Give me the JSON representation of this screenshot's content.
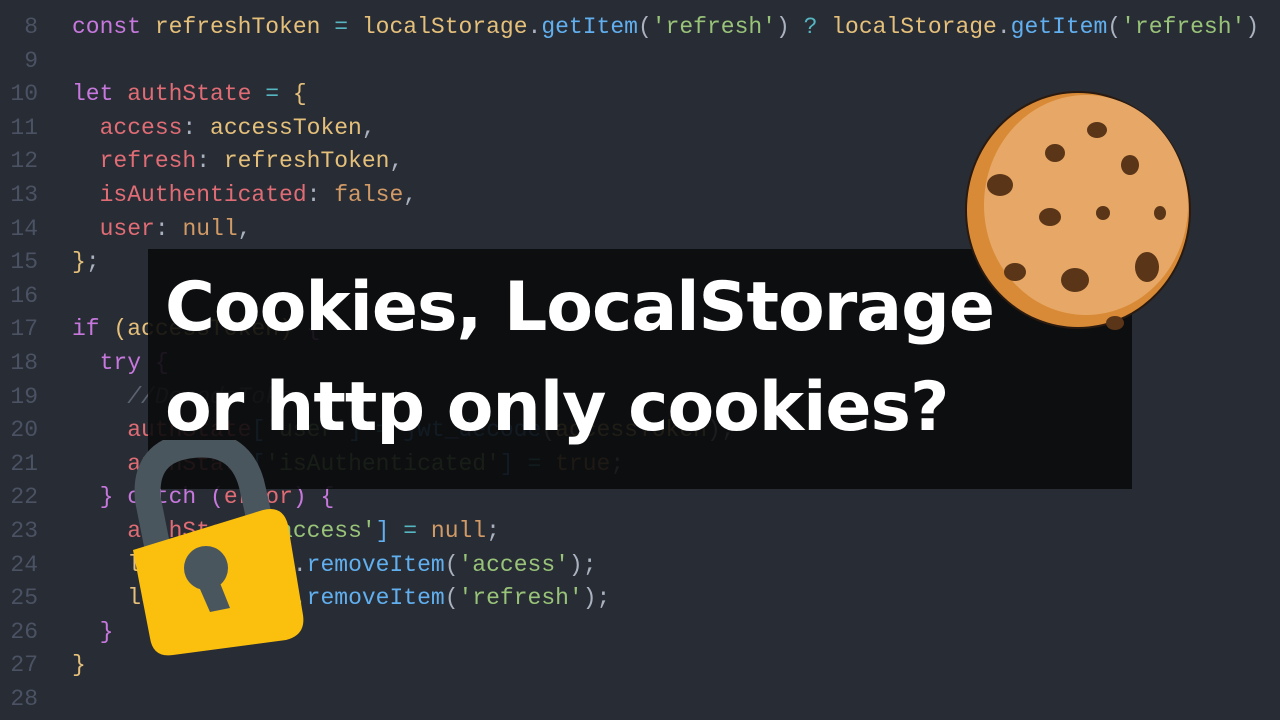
{
  "code_lines": [
    {
      "n": "8",
      "tokens": [
        [
          "const ",
          "kw"
        ],
        [
          "refreshToken ",
          "var"
        ],
        [
          "= ",
          "op"
        ],
        [
          "localStorage",
          "var"
        ],
        [
          ".",
          "txt"
        ],
        [
          "getItem",
          "fn"
        ],
        [
          "(",
          "txt"
        ],
        [
          "'refresh'",
          "str"
        ],
        [
          ") ",
          "txt"
        ],
        [
          "? ",
          "op"
        ],
        [
          "localStorage",
          "var"
        ],
        [
          ".",
          "txt"
        ],
        [
          "getItem",
          "fn"
        ],
        [
          "(",
          "txt"
        ],
        [
          "'refresh'",
          "str"
        ],
        [
          ")",
          "txt"
        ]
      ]
    },
    {
      "n": "9",
      "tokens": []
    },
    {
      "n": "10",
      "tokens": [
        [
          "let ",
          "kw"
        ],
        [
          "authState ",
          "prop"
        ],
        [
          "= ",
          "op"
        ],
        [
          "{",
          "brace"
        ]
      ]
    },
    {
      "n": "11",
      "tokens": [
        [
          "  access",
          "prop"
        ],
        [
          ": ",
          "txt"
        ],
        [
          "accessToken",
          "var"
        ],
        [
          ",",
          "txt"
        ]
      ]
    },
    {
      "n": "12",
      "tokens": [
        [
          "  refresh",
          "prop"
        ],
        [
          ": ",
          "txt"
        ],
        [
          "refreshToken",
          "var"
        ],
        [
          ",",
          "txt"
        ]
      ]
    },
    {
      "n": "13",
      "tokens": [
        [
          "  isAuthenticated",
          "prop"
        ],
        [
          ": ",
          "txt"
        ],
        [
          "false",
          "lit"
        ],
        [
          ",",
          "txt"
        ]
      ]
    },
    {
      "n": "14",
      "tokens": [
        [
          "  user",
          "prop"
        ],
        [
          ": ",
          "txt"
        ],
        [
          "null",
          "lit"
        ],
        [
          ",",
          "txt"
        ]
      ]
    },
    {
      "n": "15",
      "tokens": [
        [
          "}",
          "brace"
        ],
        [
          ";",
          "txt"
        ]
      ]
    },
    {
      "n": "16",
      "tokens": []
    },
    {
      "n": "17",
      "tokens": [
        [
          "if ",
          "kw"
        ],
        [
          "(",
          "brace"
        ],
        [
          "accessToken",
          "var"
        ],
        [
          ") ",
          "brace"
        ],
        [
          "{",
          "kw"
        ]
      ]
    },
    {
      "n": "18",
      "tokens": [
        [
          "  try ",
          "kw"
        ],
        [
          "{",
          "kw"
        ]
      ]
    },
    {
      "n": "19",
      "tokens": [
        [
          "    //DecodeToken",
          "cm"
        ]
      ]
    },
    {
      "n": "20",
      "tokens": [
        [
          "    authState",
          "prop"
        ],
        [
          "[",
          "fn"
        ],
        [
          "'user'",
          "str"
        ],
        [
          "] ",
          "fn"
        ],
        [
          "= ",
          "op"
        ],
        [
          "jwt_decode",
          "fn"
        ],
        [
          "(",
          "txt"
        ],
        [
          "accessToken",
          "var"
        ],
        [
          ");",
          "txt"
        ]
      ]
    },
    {
      "n": "21",
      "tokens": [
        [
          "    authState",
          "prop"
        ],
        [
          "[",
          "fn"
        ],
        [
          "'isAuthenticated'",
          "str"
        ],
        [
          "] ",
          "fn"
        ],
        [
          "= ",
          "op"
        ],
        [
          "true",
          "lit"
        ],
        [
          ";",
          "txt"
        ]
      ]
    },
    {
      "n": "22",
      "tokens": [
        [
          "  } ",
          "kw"
        ],
        [
          "catch ",
          "kw"
        ],
        [
          "(",
          "kw"
        ],
        [
          "error",
          "prop"
        ],
        [
          ") ",
          "kw"
        ],
        [
          "{",
          "kw"
        ]
      ]
    },
    {
      "n": "23",
      "tokens": [
        [
          "    authState",
          "prop"
        ],
        [
          "[",
          "fn"
        ],
        [
          "'access'",
          "str"
        ],
        [
          "] ",
          "fn"
        ],
        [
          "= ",
          "op"
        ],
        [
          "null",
          "lit"
        ],
        [
          ";",
          "txt"
        ]
      ]
    },
    {
      "n": "24",
      "tokens": [
        [
          "    localStorage",
          "var"
        ],
        [
          ".",
          "txt"
        ],
        [
          "removeItem",
          "fn"
        ],
        [
          "(",
          "txt"
        ],
        [
          "'access'",
          "str"
        ],
        [
          ");",
          "txt"
        ]
      ]
    },
    {
      "n": "25",
      "tokens": [
        [
          "    localStorage",
          "var"
        ],
        [
          ".",
          "txt"
        ],
        [
          "removeItem",
          "fn"
        ],
        [
          "(",
          "txt"
        ],
        [
          "'refresh'",
          "str"
        ],
        [
          ");",
          "txt"
        ]
      ]
    },
    {
      "n": "26",
      "tokens": [
        [
          "  }",
          "kw"
        ]
      ]
    },
    {
      "n": "27",
      "tokens": [
        [
          "}",
          "brace"
        ]
      ]
    },
    {
      "n": "28",
      "tokens": []
    }
  ],
  "title": {
    "line1": "Cookies, LocalStorage",
    "line2": "or http only cookies?"
  },
  "icons": {
    "cookie": "cookie-icon",
    "lock": "padlock-icon"
  },
  "colors": {
    "background": "#282c34",
    "lock": "#fbbf0e",
    "cookie": "#e7a867"
  }
}
